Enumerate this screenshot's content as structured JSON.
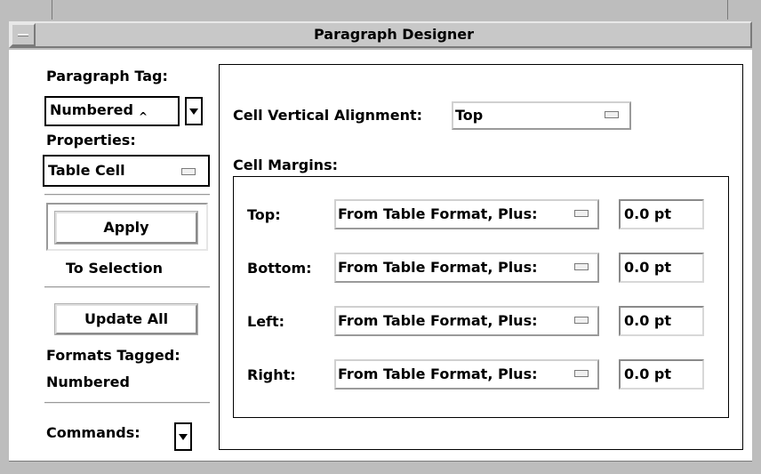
{
  "window": {
    "title": "Paragraph Designer"
  },
  "left": {
    "paragraph_tag_label": "Paragraph Tag:",
    "paragraph_tag_value": "Numbered",
    "properties_label": "Properties:",
    "properties_value": "Table Cell",
    "apply_label": "Apply",
    "to_selection_label": "To Selection",
    "update_all_label": "Update All",
    "formats_tagged_label": "Formats Tagged:",
    "formats_tagged_value": "Numbered",
    "commands_label": "Commands:"
  },
  "right": {
    "cell_vertical_alignment_label": "Cell Vertical Alignment:",
    "cell_vertical_alignment_value": "Top",
    "cell_margins_label": "Cell Margins:",
    "margins": [
      {
        "label": "Top:",
        "source": "From Table Format, Plus:",
        "value": "0.0 pt"
      },
      {
        "label": "Bottom:",
        "source": "From Table Format, Plus:",
        "value": "0.0 pt"
      },
      {
        "label": "Left:",
        "source": "From Table Format, Plus:",
        "value": "0.0 pt"
      },
      {
        "label": "Right:",
        "source": "From Table Format, Plus:",
        "value": "0.0 pt"
      }
    ]
  }
}
